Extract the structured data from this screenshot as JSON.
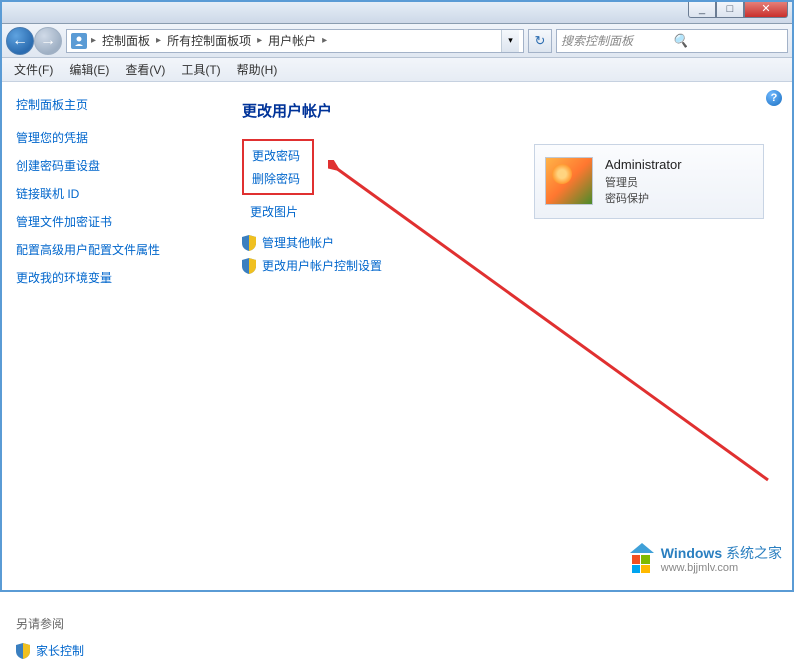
{
  "titlebar": {
    "min": "_",
    "max": "□",
    "close": "✕"
  },
  "nav": {
    "back": "←",
    "fwd": "→",
    "breadcrumb": [
      "控制面板",
      "所有控制面板项",
      "用户帐户"
    ],
    "refresh": "↻"
  },
  "search": {
    "placeholder": "搜索控制面板",
    "icon": "🔍"
  },
  "menu": {
    "file": "文件(F)",
    "edit": "编辑(E)",
    "view": "查看(V)",
    "tools": "工具(T)",
    "help": "帮助(H)"
  },
  "sidebar": {
    "home": "控制面板主页",
    "links": [
      "管理您的凭据",
      "创建密码重设盘",
      "链接联机 ID",
      "管理文件加密证书",
      "配置高级用户配置文件属性",
      "更改我的环境变量"
    ],
    "footer_label": "另请参阅",
    "footer_link": "家长控制"
  },
  "main": {
    "title": "更改用户帐户",
    "highlighted": [
      "更改密码",
      "删除密码"
    ],
    "pic_link": "更改图片",
    "shield_links": [
      "管理其他帐户",
      "更改用户帐户控制设置"
    ]
  },
  "user": {
    "name": "Administrator",
    "role": "管理员",
    "status": "密码保护"
  },
  "help": "?",
  "watermark": {
    "brand": "Windows",
    "suffix": "系统之家",
    "url": "www.bjjmlv.com"
  }
}
